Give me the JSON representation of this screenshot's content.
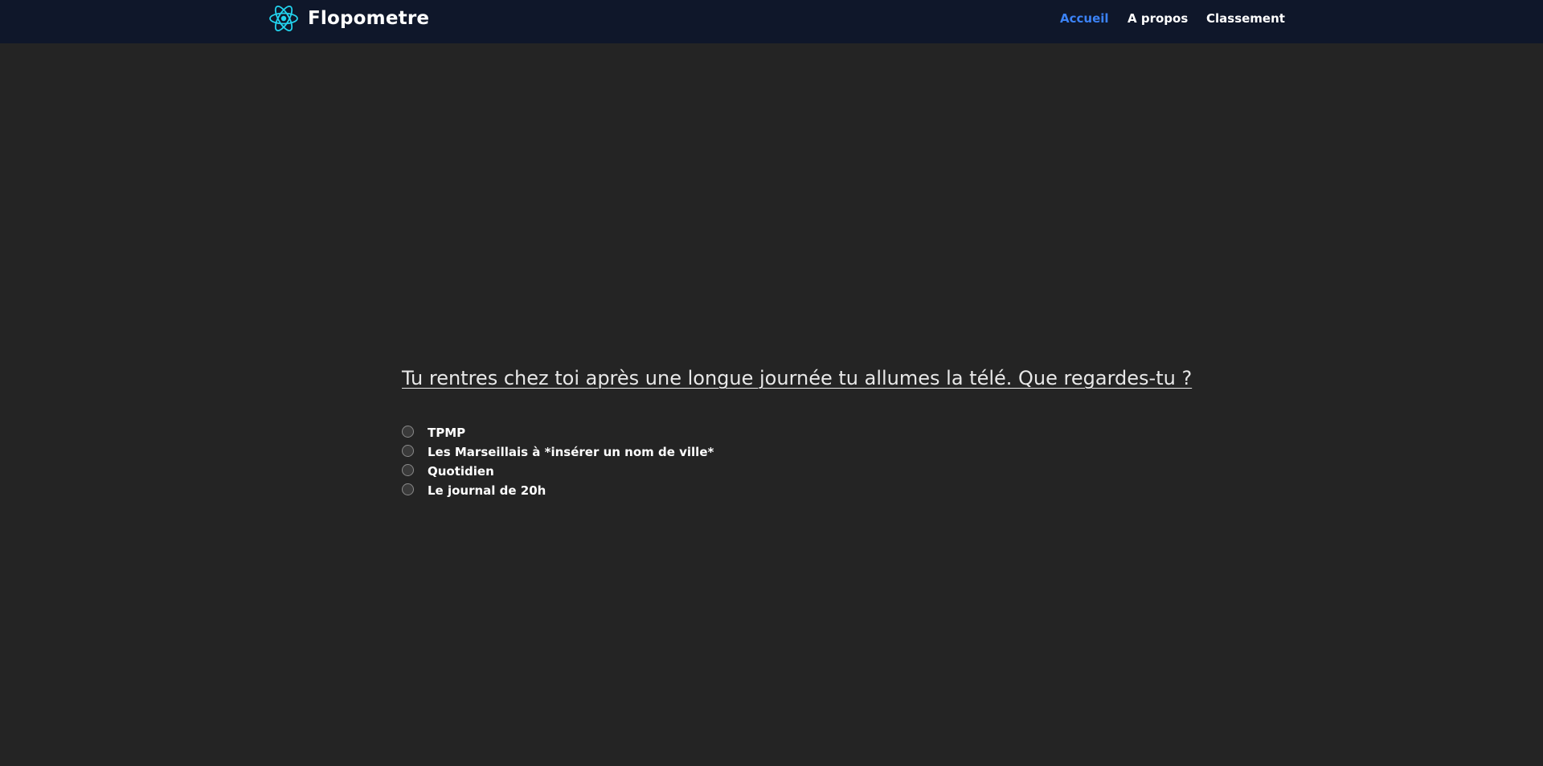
{
  "navbar": {
    "brand": "Flopometre",
    "logo_icon": "react-atom-icon",
    "logo_color": "#22d3ee",
    "links": [
      {
        "label": "Accueil",
        "active": true
      },
      {
        "label": "A propos",
        "active": false
      },
      {
        "label": "Classement",
        "active": false
      }
    ],
    "active_color": "#3b82f6",
    "background": "#0f172a"
  },
  "quiz": {
    "question": "Tu rentres chez toi après une longue journée tu allumes la télé. Que regardes-tu ?",
    "options": [
      {
        "label": "TPMP",
        "selected": false
      },
      {
        "label": "Les Marseillais à *insérer un nom de ville*",
        "selected": false
      },
      {
        "label": "Quotidien",
        "selected": false
      },
      {
        "label": "Le journal de 20h",
        "selected": false
      }
    ]
  },
  "page": {
    "background": "#242424"
  }
}
